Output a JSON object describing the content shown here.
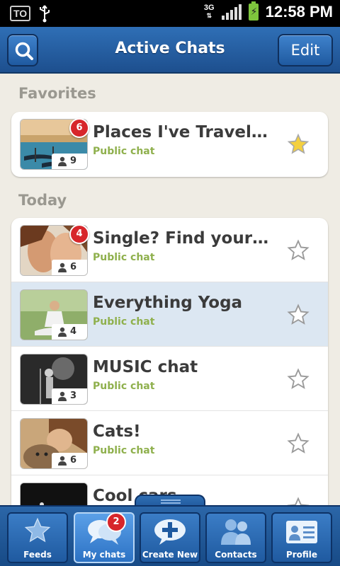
{
  "status_bar": {
    "left_icons": [
      "to-icon",
      "usb-icon"
    ],
    "carrier_badge": "TO",
    "network": "3G",
    "time": "12:58 PM"
  },
  "header": {
    "title": "Active Chats",
    "edit_label": "Edit",
    "search_icon": "search-icon"
  },
  "sections": {
    "favorites": "Favorites",
    "today": "Today"
  },
  "favorites": [
    {
      "title": "Places I've Traveled",
      "subtitle": "Public chat",
      "members": "9",
      "badge": "6",
      "starred": true
    }
  ],
  "today": [
    {
      "title": "Single? Find your m...",
      "subtitle": "Public chat",
      "members": "6",
      "badge": "4",
      "starred": false,
      "selected": false
    },
    {
      "title": "Everything Yoga",
      "subtitle": "Public chat",
      "members": "4",
      "badge": "",
      "starred": false,
      "selected": true
    },
    {
      "title": "MUSIC chat",
      "subtitle": "Public chat",
      "members": "3",
      "badge": "",
      "starred": false,
      "selected": false
    },
    {
      "title": "Cats!",
      "subtitle": "Public chat",
      "members": "6",
      "badge": "",
      "starred": false,
      "selected": false
    },
    {
      "title": "Cool cars",
      "subtitle": "",
      "members": "",
      "badge": "",
      "starred": false,
      "selected": false
    }
  ],
  "tabs": [
    {
      "label": "Feeds",
      "icon": "star-icon",
      "active": false
    },
    {
      "label": "My chats",
      "icon": "chat-bubbles-icon",
      "active": true,
      "badge": "2"
    },
    {
      "label": "Create New",
      "icon": "plus-bubble-icon",
      "active": false
    },
    {
      "label": "Contacts",
      "icon": "people-icon",
      "active": false
    },
    {
      "label": "Profile",
      "icon": "profile-card-icon",
      "active": false
    }
  ],
  "colors": {
    "header_blue": "#2f6fb6",
    "subtitle_green": "#8fb04d",
    "badge_red": "#d7262b",
    "selected_row": "#dce7f2",
    "star_gold": "#f4d03f"
  }
}
